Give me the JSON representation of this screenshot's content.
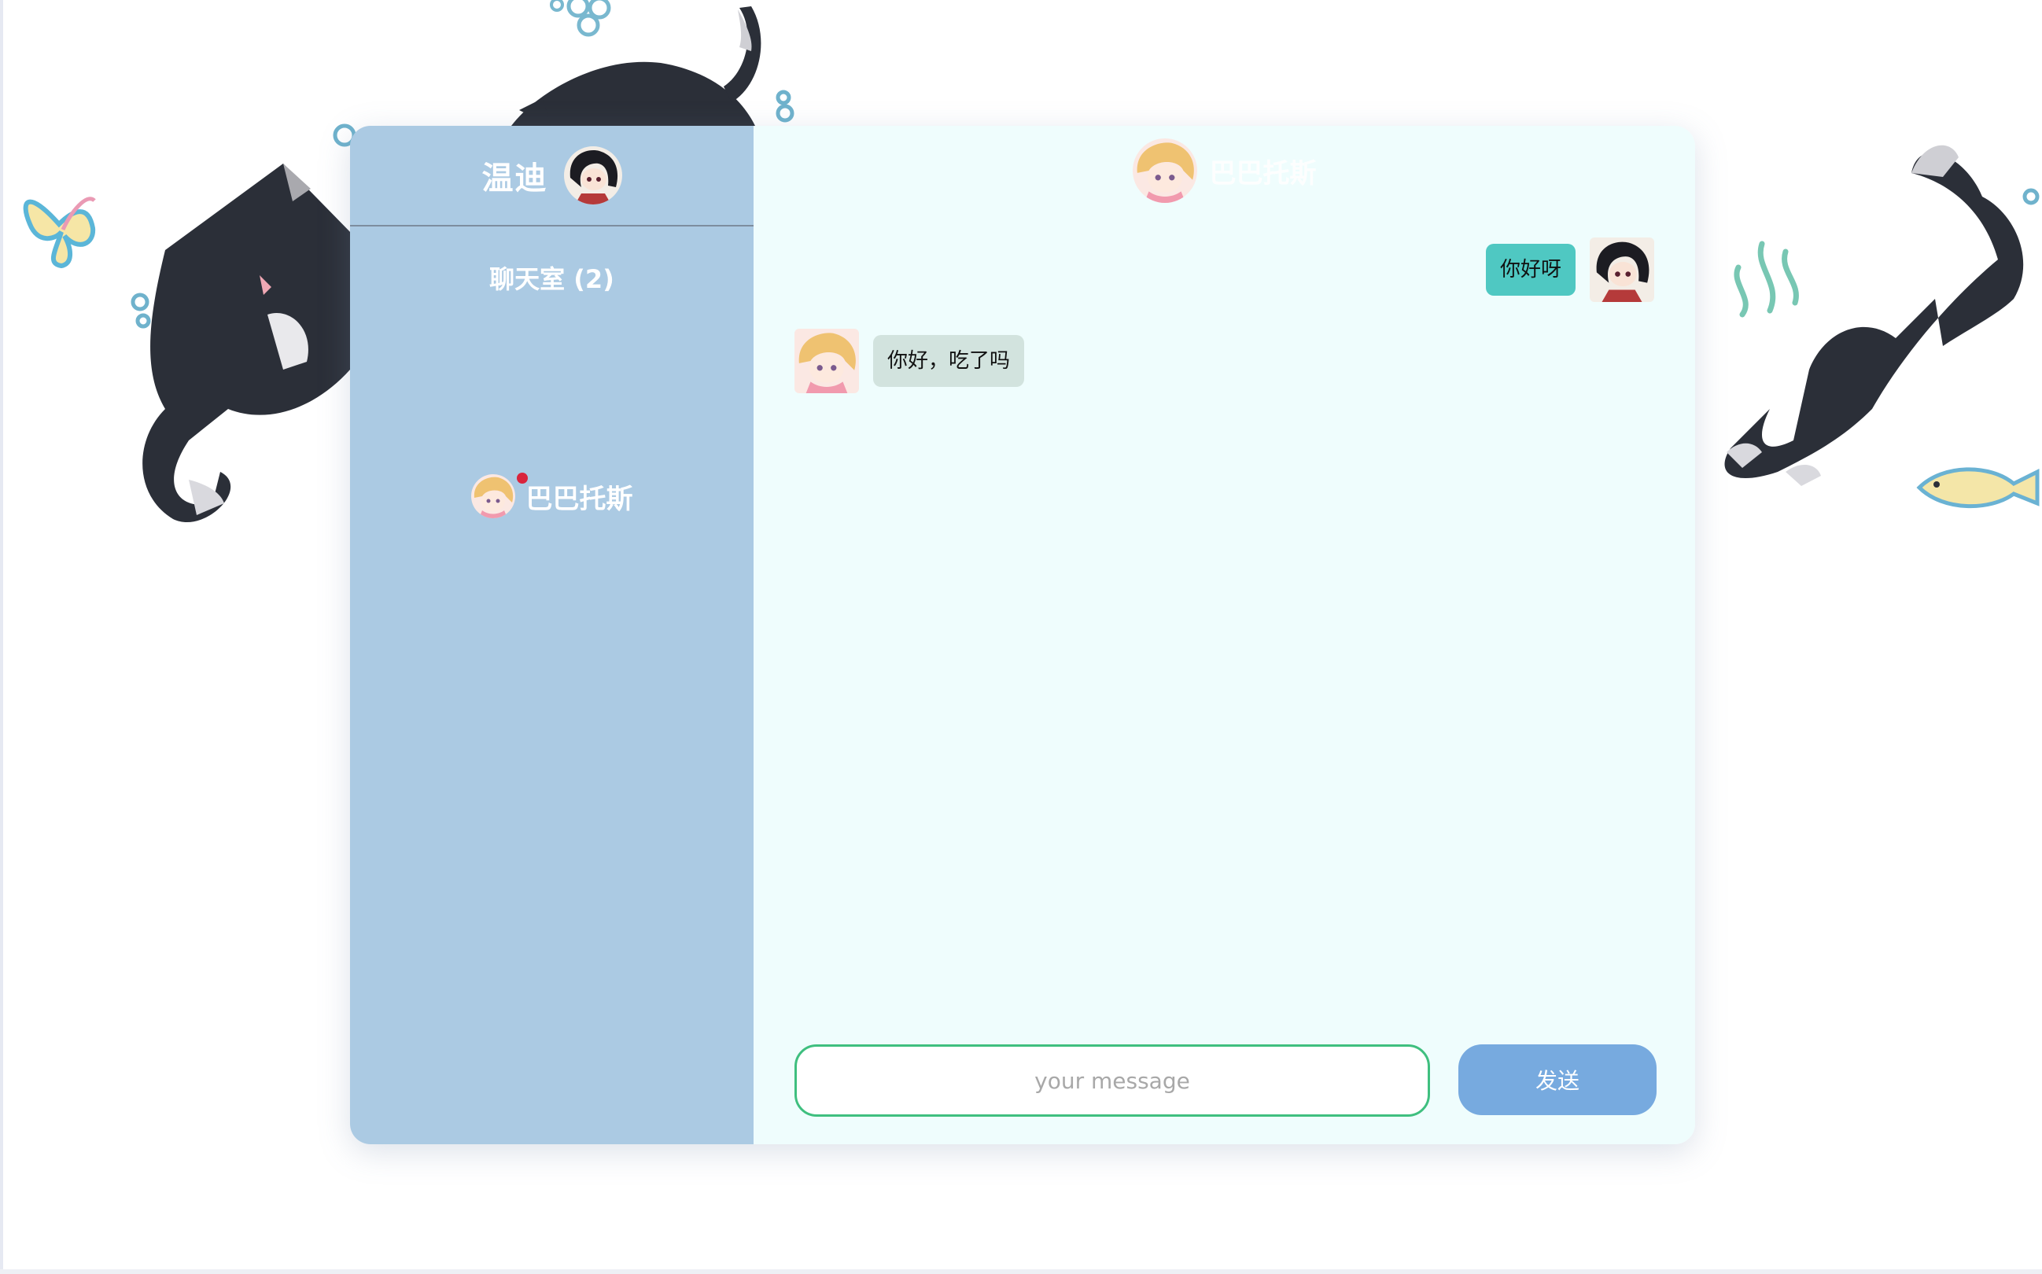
{
  "user": {
    "name": "温迪"
  },
  "sidebar": {
    "room_title": "聊天室 (2)",
    "contacts": [
      {
        "name": "巴巴托斯",
        "unread": true
      }
    ]
  },
  "chat": {
    "partner_name": "巴巴托斯",
    "messages": [
      {
        "direction": "sent",
        "text": "你好呀"
      },
      {
        "direction": "received",
        "text": "你好，吃了吗"
      }
    ]
  },
  "composer": {
    "placeholder": "your message",
    "send_label": "发送"
  },
  "colors": {
    "sidebar_bg": "#abcae3",
    "chat_bg": "#effdfd",
    "sent_bubble": "#4fc8c2",
    "received_bubble": "#d2e3de",
    "send_button": "#77aadf",
    "input_border": "#3fbf7f",
    "unread_dot": "#d9243d"
  }
}
